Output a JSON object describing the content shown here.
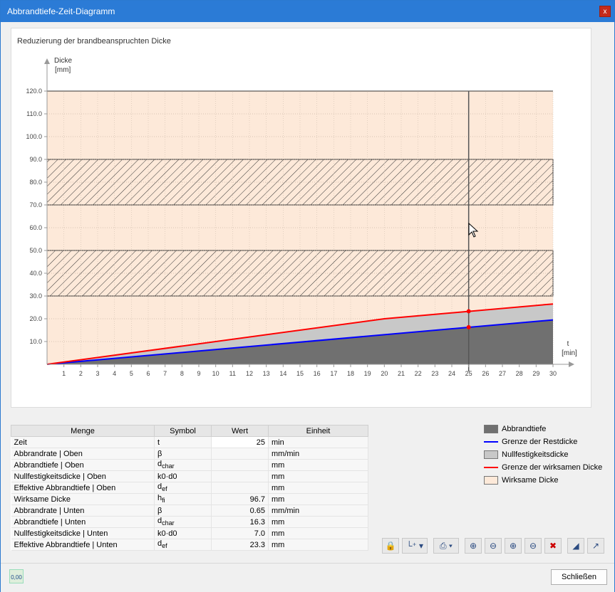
{
  "window": {
    "title": "Abbrandtiefe-Zeit-Diagramm",
    "close_glyph": "x"
  },
  "chart_title": "Reduzierung der brandbeanspruchten Dicke",
  "chart_data": {
    "type": "area",
    "title": "Reduzierung der brandbeanspruchten Dicke",
    "ylabel": "Dicke",
    "yunit": "[mm]",
    "xlabel": "t",
    "xunit": "[min]",
    "xlim": [
      0,
      30
    ],
    "ylim": [
      0,
      120
    ],
    "x_ticks": [
      1,
      2,
      3,
      4,
      5,
      6,
      7,
      8,
      9,
      10,
      11,
      12,
      13,
      14,
      15,
      16,
      17,
      18,
      19,
      20,
      21,
      22,
      23,
      24,
      25,
      26,
      27,
      28,
      29,
      30
    ],
    "y_ticks": [
      "10.0",
      "20.0",
      "30.0",
      "40.0",
      "50.0",
      "60.0",
      "70.0",
      "80.0",
      "90.0",
      "100.0",
      "110.0",
      "120.0"
    ],
    "grid": true,
    "cursor_x": 25,
    "hatched_bands": [
      [
        30,
        50
      ],
      [
        70,
        90
      ]
    ],
    "effective_band": [
      0,
      120
    ],
    "series": [
      {
        "name": "Abbrandtiefe",
        "x": [
          0,
          30
        ],
        "y": [
          0,
          19.5
        ],
        "color": "#707070"
      },
      {
        "name": "Grenze der Restdicke",
        "x": [
          0,
          30
        ],
        "y": [
          0,
          19.5
        ],
        "color": "#0000ff"
      },
      {
        "name": "Nullfestigkeitsdicke",
        "x": [
          0,
          20,
          30
        ],
        "y": [
          0,
          20,
          26.5
        ],
        "color": "#c8c8c8"
      },
      {
        "name": "Grenze der wirksamen Dicke",
        "x": [
          0,
          20,
          30
        ],
        "y": [
          0,
          20,
          26.5
        ],
        "color": "#ff0000"
      }
    ],
    "markers": [
      {
        "x": 25,
        "y": 23.3,
        "color": "#ff0000"
      },
      {
        "x": 25,
        "y": 16.3,
        "color": "#ff0000"
      }
    ]
  },
  "table": {
    "headers": [
      "Menge",
      "Symbol",
      "Wert",
      "Einheit"
    ],
    "rows": [
      {
        "menge": "Zeit",
        "symbol": "t",
        "sub": "",
        "wert": "25",
        "einheit": "min"
      },
      {
        "menge": "Abbrandrate | Oben",
        "symbol": "β",
        "sub": "",
        "wert": "",
        "einheit": "mm/min"
      },
      {
        "menge": "Abbrandtiefe | Oben",
        "symbol": "d",
        "sub": "char",
        "wert": "",
        "einheit": "mm"
      },
      {
        "menge": "Nullfestigkeitsdicke | Oben",
        "symbol": "k0·d0",
        "sub": "",
        "wert": "",
        "einheit": "mm"
      },
      {
        "menge": "Effektive Abbrandtiefe | Oben",
        "symbol": "d",
        "sub": "ef",
        "wert": "",
        "einheit": "mm"
      },
      {
        "menge": "Wirksame Dicke",
        "symbol": "h",
        "sub": "fi",
        "wert": "96.7",
        "einheit": "mm"
      },
      {
        "menge": "Abbrandrate | Unten",
        "symbol": "β",
        "sub": "",
        "wert": "0.65",
        "einheit": "mm/min"
      },
      {
        "menge": "Abbrandtiefe | Unten",
        "symbol": "d",
        "sub": "char",
        "wert": "16.3",
        "einheit": "mm"
      },
      {
        "menge": "Nullfestigkeitsdicke | Unten",
        "symbol": "k0·d0",
        "sub": "",
        "wert": "7.0",
        "einheit": "mm"
      },
      {
        "menge": "Effektive Abbrandtiefe | Unten",
        "symbol": "d",
        "sub": "ef",
        "wert": "23.3",
        "einheit": "mm"
      }
    ]
  },
  "legend": [
    {
      "label": "Abbrandtiefe",
      "kind": "swatch",
      "color": "#707070"
    },
    {
      "label": "Grenze der Restdicke",
      "kind": "line",
      "color": "#0000ff"
    },
    {
      "label": "Nullfestigkeitsdicke",
      "kind": "swatch",
      "color": "#c8c8c8"
    },
    {
      "label": "Grenze der wirksamen Dicke",
      "kind": "line",
      "color": "#ff0000"
    },
    {
      "label": "Wirksame Dicke",
      "kind": "swatch",
      "color": "#fde9d9"
    }
  ],
  "toolbar": {
    "buttons": [
      "lock-icon",
      "axis-add-icon",
      "print-icon",
      "zoom-in-x-icon",
      "zoom-out-x-icon",
      "zoom-in-y-icon",
      "zoom-out-y-icon",
      "zoom-reset-icon",
      "chart-view-icon",
      "chart-axis-icon"
    ]
  },
  "footer": {
    "calc_label": "0,00",
    "close_label": "Schließen"
  }
}
